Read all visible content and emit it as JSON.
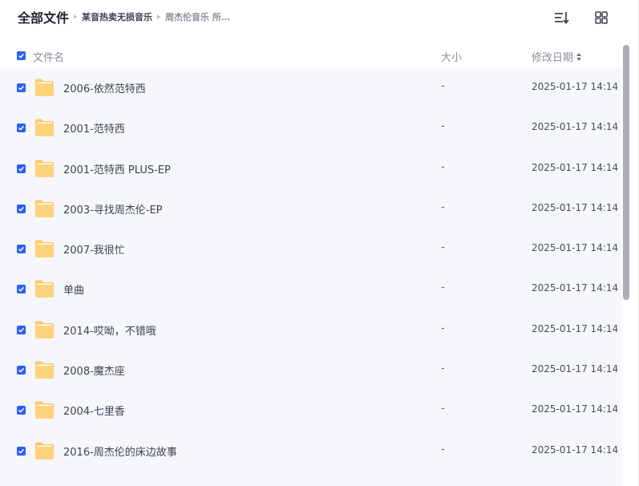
{
  "breadcrumb": {
    "root": "全部文件",
    "items": [
      "某音热卖无损音乐",
      "周杰伦音乐 所…"
    ]
  },
  "toolbar": {
    "sort_icon": "sort-icon",
    "grid_icon": "grid-view-icon"
  },
  "columns": {
    "name": "文件名",
    "size": "大小",
    "modified": "修改日期"
  },
  "colors": {
    "accent": "#2b5ff5",
    "folder": "#ffc864",
    "list_bg": "#f6f7fc"
  },
  "rows": [
    {
      "name": "2006-依然范特西",
      "size": "-",
      "modified": "2025-01-17 14:14"
    },
    {
      "name": "2001-范特西",
      "size": "-",
      "modified": "2025-01-17 14:14"
    },
    {
      "name": "2001-范特西 PLUS-EP",
      "size": "-",
      "modified": "2025-01-17 14:14"
    },
    {
      "name": "2003-寻找周杰伦-EP",
      "size": "-",
      "modified": "2025-01-17 14:14"
    },
    {
      "name": "2007-我很忙",
      "size": "-",
      "modified": "2025-01-17 14:14"
    },
    {
      "name": "单曲",
      "size": "-",
      "modified": "2025-01-17 14:14"
    },
    {
      "name": "2014-哎呦，不错哦",
      "size": "-",
      "modified": "2025-01-17 14:14"
    },
    {
      "name": "2008-魔杰座",
      "size": "-",
      "modified": "2025-01-17 14:14"
    },
    {
      "name": "2004-七里香",
      "size": "-",
      "modified": "2025-01-17 14:14"
    },
    {
      "name": "2016-周杰伦的床边故事",
      "size": "-",
      "modified": "2025-01-17 14:14"
    }
  ]
}
